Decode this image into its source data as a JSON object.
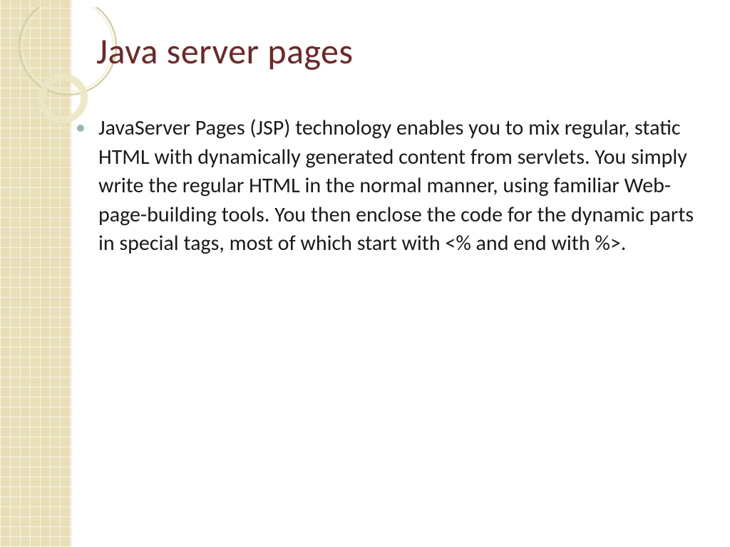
{
  "slide": {
    "title": "Java server pages",
    "bullets": [
      "JavaServer Pages (JSP) technology enables you to mix regular, static HTML with dynamically generated content from servlets. You simply write the regular HTML in the normal manner, using familiar Web-page-building tools. You then enclose the code for the dynamic parts in special tags, most of which start with <% and end with %>."
    ]
  },
  "theme": {
    "title_color": "#6b2a2a",
    "bullet_color": "#9db8b0",
    "sidebar_color": "#e8dfb8"
  }
}
